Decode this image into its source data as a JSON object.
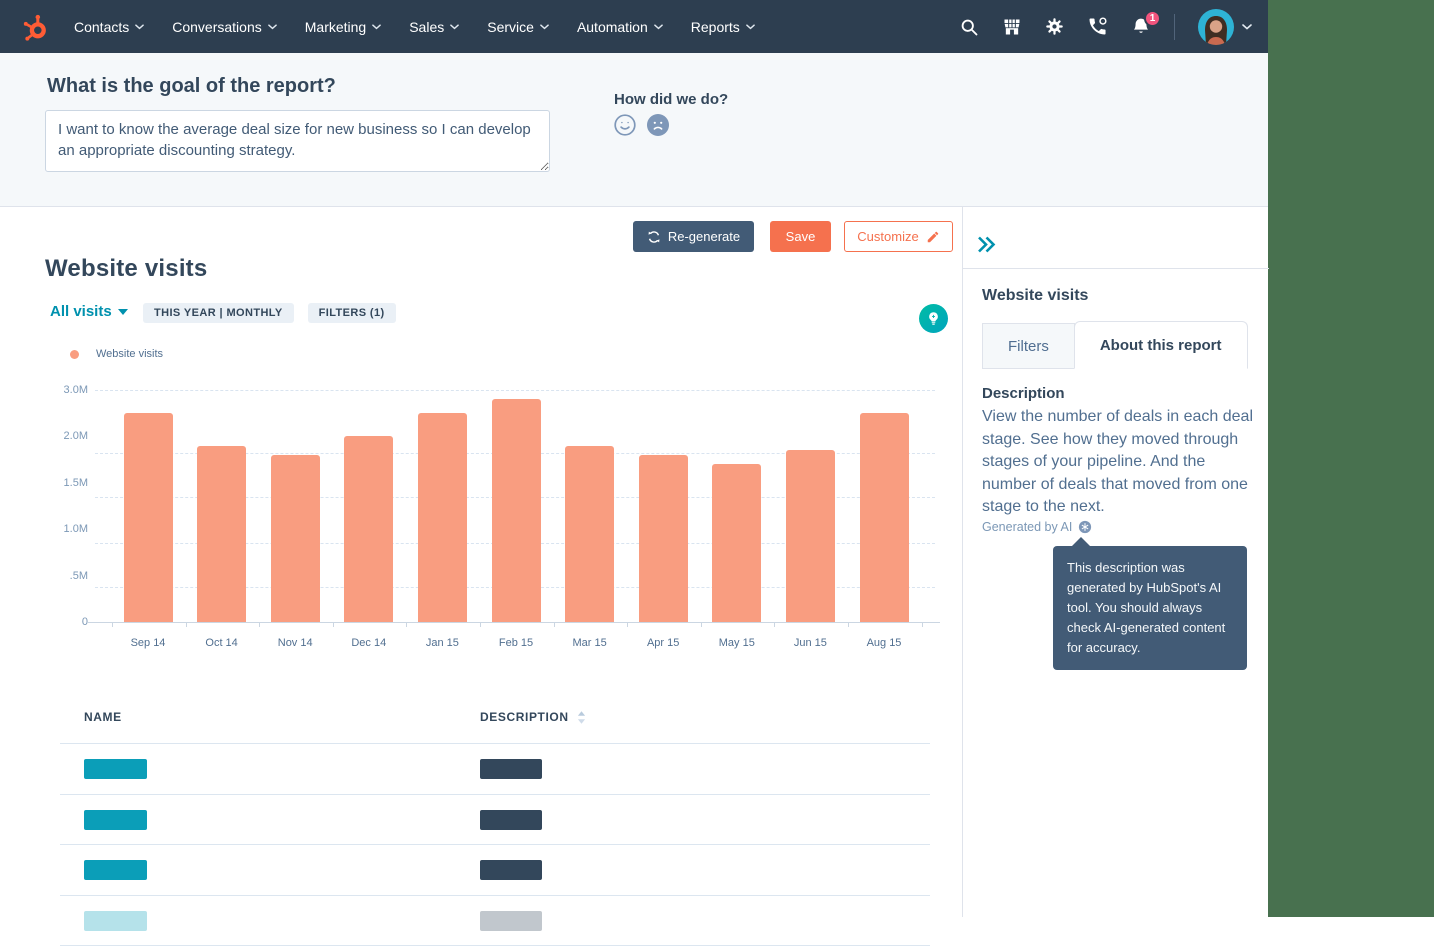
{
  "app": {
    "brand": "HubSpot",
    "logo_color": "#ff5c35"
  },
  "nav": {
    "items": [
      "Contacts",
      "Conversations",
      "Marketing",
      "Sales",
      "Service",
      "Automation",
      "Reports"
    ],
    "notification_badge": "1"
  },
  "goal_panel": {
    "title": "What is the goal of the report?",
    "goal_text": "I want to know the average deal size for new business so I can develop an appropriate discounting strategy.",
    "feedback_label": "How did we do?"
  },
  "toolbar": {
    "regenerate_label": "Re-generate",
    "save_label": "Save",
    "customize_label": "Customize"
  },
  "report": {
    "title": "Website visits",
    "breakdown_selector": "All visits",
    "badges": [
      "THIS YEAR | MONTHLY",
      "FILTERS (1)"
    ],
    "legend": [
      {
        "label": "Website visits",
        "color": "#f99d80"
      }
    ]
  },
  "chart_data": {
    "type": "bar",
    "title": "Website visits",
    "series_name": "Website visits",
    "categories": [
      "Sep 14",
      "Oct 14",
      "Nov 14",
      "Dec 14",
      "Jan 15",
      "Feb 15",
      "Mar 15",
      "Apr 15",
      "May 15",
      "Jun 15",
      "Aug 15"
    ],
    "values": [
      2.5,
      1.9,
      1.8,
      2.0,
      2.5,
      2.8,
      1.9,
      1.8,
      1.7,
      1.85,
      2.5
    ],
    "unit": "M",
    "ylim": [
      0,
      3.0
    ],
    "bar_color": "#f99d80",
    "grid": "dashed-horizontal",
    "legend_position": "top-left",
    "y_ticks": [
      {
        "label": "3.0M",
        "value": 3.0,
        "axis_fraction": 1.0
      },
      {
        "label": "2.0M",
        "value": 2.0,
        "axis_fraction": 0.8
      },
      {
        "label": "1.5M",
        "value": 1.5,
        "axis_fraction": 0.6
      },
      {
        "label": "1.0M",
        "value": 1.0,
        "axis_fraction": 0.4
      },
      {
        "label": ".5M",
        "value": 0.5,
        "axis_fraction": 0.2
      },
      {
        "label": "0",
        "value": 0,
        "axis_fraction": 0.0
      }
    ],
    "gridline_fractions": [
      1.0,
      0.73,
      0.54,
      0.34,
      0.15
    ]
  },
  "table": {
    "columns": [
      {
        "label": "NAME",
        "sortable": false
      },
      {
        "label": "DESCRIPTION",
        "sortable": true
      }
    ],
    "placeholder_rows": 4,
    "name_bar_color": "#0b9eb8",
    "description_bar_color": "#33475b"
  },
  "sidebar": {
    "title": "Website visits",
    "tabs": [
      {
        "label": "Filters",
        "active": false
      },
      {
        "label": "About this report",
        "active": true
      }
    ],
    "description_heading": "Description",
    "description_text": "View the number of deals in each deal stage. See how they moved through stages of your pipeline. And the number of deals that moved from one stage to the next.",
    "generated_by_label": "Generated by AI",
    "ai_tooltip": "This description was generated by HubSpot's AI tool. You should always check AI-generated content for accuracy."
  },
  "colors": {
    "nav_bg": "#2d3e50",
    "accent_orange": "#f5714e",
    "link_teal": "#0091ae",
    "panel_bg": "#f5f8fa",
    "badge_bg": "#eaf0f6",
    "heading_navy": "#33475b",
    "body_blue_grey": "#516f90",
    "tooltip_bg": "#425b76",
    "backdrop_green": "#48714f",
    "notification_pink": "#f2547d"
  }
}
